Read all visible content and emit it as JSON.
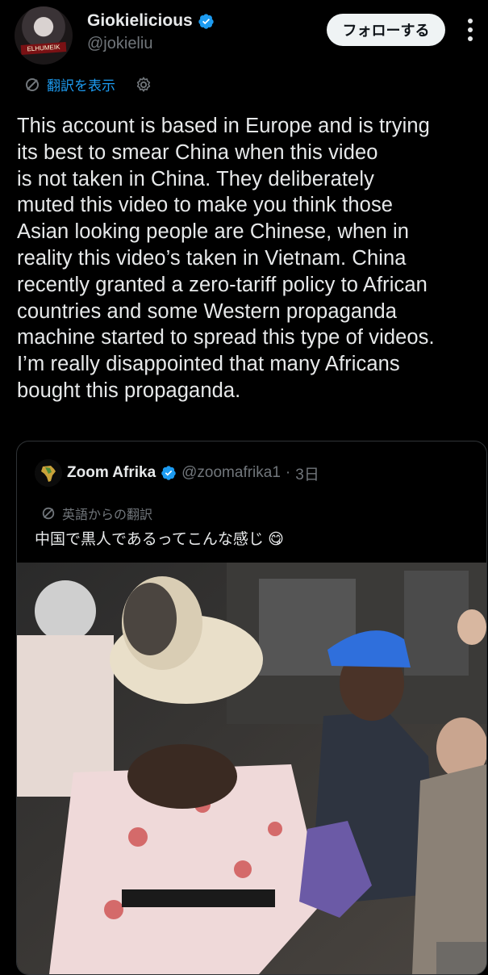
{
  "header": {
    "name": "Giokielicious",
    "handle": "@jokieliu",
    "follow_label": "フォローする",
    "avatar_text": "ELHUMEIK"
  },
  "translate": {
    "label": "翻訳を表示"
  },
  "post": {
    "text": "This account is based in Europe and is trying\nits best to smear China when this video\nis not taken in China. They deliberately\nmuted this video to make you think those\nAsian looking people are Chinese, when in\nreality this video’s taken in Vietnam. China\nrecently granted a zero-tariff policy to African\ncountries and some Western propaganda\nmachine started to spread this type of videos.\nI’m really disappointed that many Africans\nbought this propaganda."
  },
  "quote": {
    "name": "Zoom Afrika",
    "handle": "@zoomafrika1",
    "separator": "·",
    "time": "3日",
    "translated_from": "英語からの翻訳",
    "text": "中国で黒人であるってこんな感じ",
    "emoji": "😋"
  },
  "colors": {
    "accent": "#1d9bf0",
    "background": "#000000",
    "muted": "#71767b"
  }
}
